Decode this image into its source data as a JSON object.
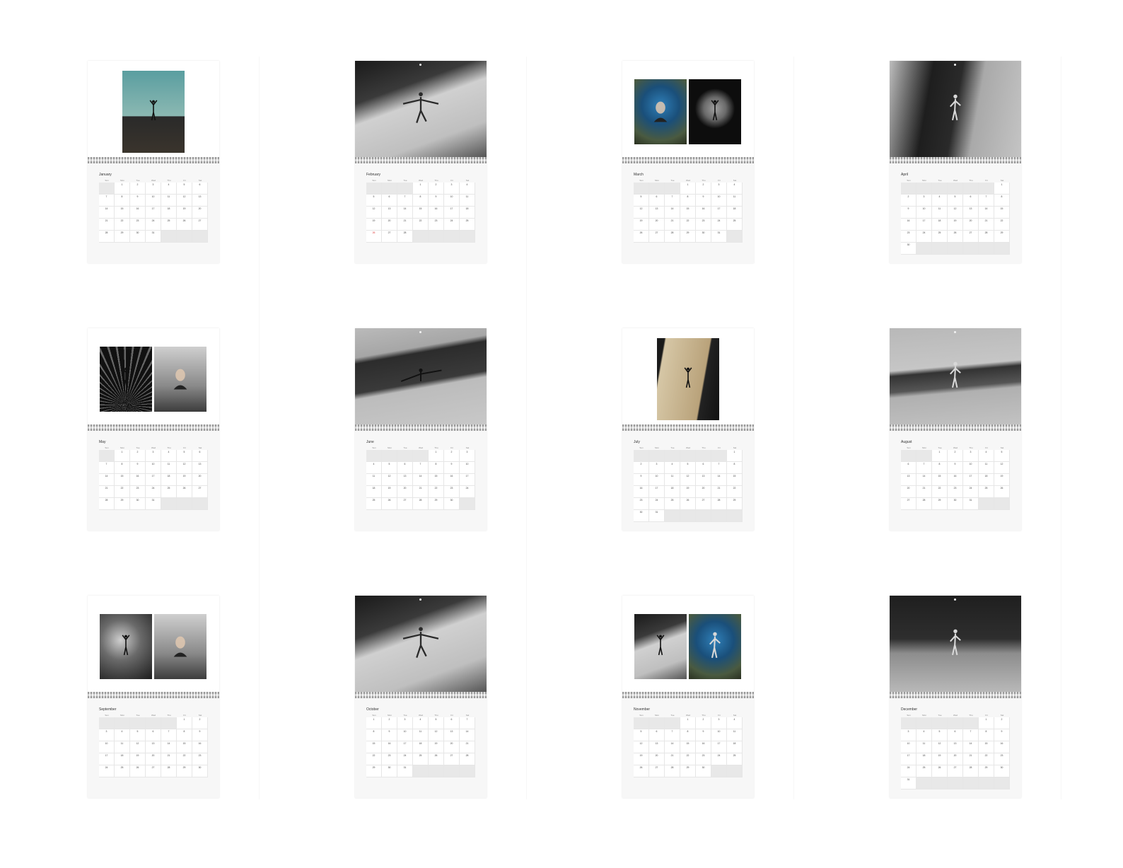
{
  "weekdays": [
    "Sun",
    "Mon",
    "Tue",
    "Wed",
    "Thu",
    "Fri",
    "Sat"
  ],
  "months": [
    {
      "name": "January",
      "start": 1,
      "days": 31,
      "layout": "single",
      "photos": [
        {
          "kind": "teal-sky",
          "icon": "dancer-silhouette-icon"
        }
      ]
    },
    {
      "name": "February",
      "start": 3,
      "days": 28,
      "layout": "full",
      "photos": [
        {
          "kind": "grey-arch",
          "icon": "dancer-arms-out-icon"
        }
      ],
      "red": [
        26
      ]
    },
    {
      "name": "March",
      "start": 3,
      "days": 31,
      "layout": "double",
      "photos": [
        {
          "kind": "blue-portrait",
          "icon": "face-portrait-icon"
        },
        {
          "kind": "dark-frame",
          "icon": "dancer-silhouette-icon"
        }
      ]
    },
    {
      "name": "April",
      "start": 6,
      "days": 30,
      "layout": "full",
      "photos": [
        {
          "kind": "concrete-wall",
          "icon": "figure-pose-icon"
        }
      ]
    },
    {
      "name": "May",
      "start": 1,
      "days": 31,
      "layout": "double",
      "photos": [
        {
          "kind": "dark-rays",
          "icon": "dancer-silhouette-icon"
        },
        {
          "kind": "grey-portrait",
          "icon": "face-portrait-icon"
        }
      ]
    },
    {
      "name": "June",
      "start": 4,
      "days": 30,
      "layout": "full",
      "photos": [
        {
          "kind": "concrete-shadow",
          "icon": "reclining-figure-icon"
        }
      ]
    },
    {
      "name": "July",
      "start": 6,
      "days": 31,
      "layout": "single",
      "photos": [
        {
          "kind": "warm-sunset",
          "icon": "dancer-silhouette-icon"
        }
      ]
    },
    {
      "name": "August",
      "start": 2,
      "days": 31,
      "layout": "full",
      "photos": [
        {
          "kind": "concrete-bright",
          "icon": "figure-pose-icon"
        }
      ]
    },
    {
      "name": "September",
      "start": 5,
      "days": 30,
      "layout": "double",
      "photos": [
        {
          "kind": "storm-sky",
          "icon": "dancer-silhouette-icon"
        },
        {
          "kind": "grey-portrait",
          "icon": "face-portrait-icon"
        }
      ]
    },
    {
      "name": "October",
      "start": 0,
      "days": 31,
      "layout": "full",
      "photos": [
        {
          "kind": "grey-arch",
          "icon": "dancer-arms-out-icon"
        }
      ]
    },
    {
      "name": "November",
      "start": 3,
      "days": 30,
      "layout": "double",
      "photos": [
        {
          "kind": "grey-arch",
          "icon": "dancer-silhouette-icon"
        },
        {
          "kind": "blue-portrait",
          "icon": "figure-pose-icon"
        }
      ]
    },
    {
      "name": "December",
      "start": 5,
      "days": 31,
      "layout": "full",
      "photos": [
        {
          "kind": "dark-sky",
          "icon": "figure-pose-icon"
        }
      ]
    }
  ],
  "colors": {
    "background": "#ffffff",
    "out_cell": "#e8e8e8",
    "weekend_red": "#d33333"
  }
}
